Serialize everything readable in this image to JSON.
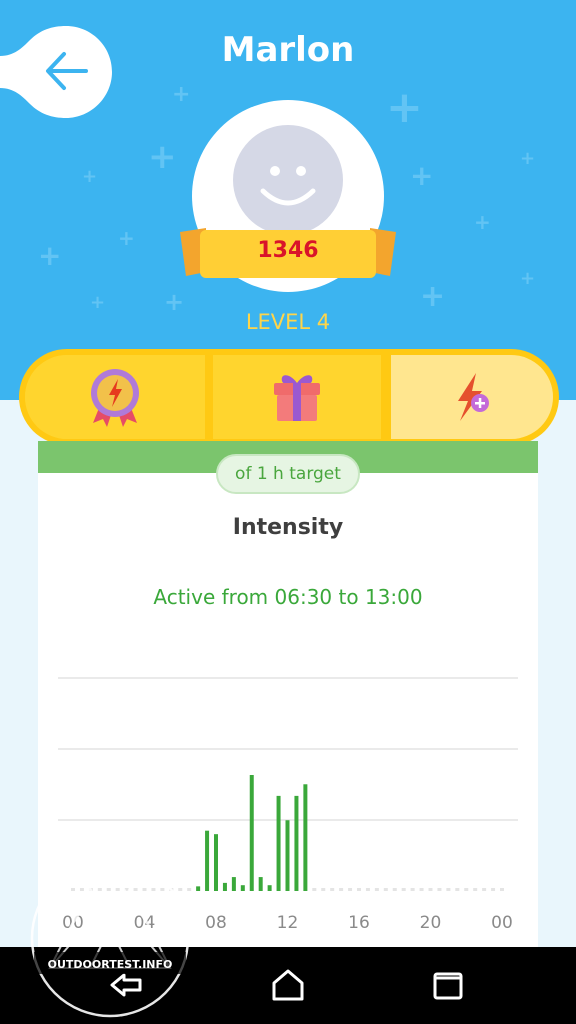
{
  "header": {
    "title": "Marlon",
    "score": "1346",
    "level": "LEVEL 4"
  },
  "icons": {
    "back": "arrow-left-icon",
    "tab1": "badge-lightning-icon",
    "tab2": "gift-icon",
    "tab3": "lightning-plus-icon",
    "nav_back": "nav-back-icon",
    "nav_home": "nav-home-icon",
    "nav_recents": "nav-recents-icon"
  },
  "card": {
    "target": "of 1 h target",
    "title": "Intensity",
    "active": "Active from 06:30 to 13:00"
  },
  "colors": {
    "header_blue": "#3cb4f0",
    "tabbar_yellow": "#ffc913",
    "score_red": "#d9142a",
    "level_yellow": "#ffd54a",
    "activity_green": "#3aa83a",
    "card_green": "#7bc56d"
  },
  "chart_data": {
    "type": "bar",
    "title": "Intensity",
    "x_ticks": [
      "00",
      "04",
      "08",
      "12",
      "16",
      "20",
      "00"
    ],
    "x_range_hours": [
      0,
      24
    ],
    "ylim": [
      0,
      1
    ],
    "values": [
      {
        "x": 7.0,
        "y": 0.04
      },
      {
        "x": 7.5,
        "y": 0.52
      },
      {
        "x": 8.0,
        "y": 0.49
      },
      {
        "x": 8.5,
        "y": 0.07
      },
      {
        "x": 9.0,
        "y": 0.12
      },
      {
        "x": 9.5,
        "y": 0.05
      },
      {
        "x": 10.0,
        "y": 1.0
      },
      {
        "x": 10.5,
        "y": 0.12
      },
      {
        "x": 11.0,
        "y": 0.05
      },
      {
        "x": 11.5,
        "y": 0.82
      },
      {
        "x": 12.0,
        "y": 0.61
      },
      {
        "x": 12.5,
        "y": 0.82
      },
      {
        "x": 13.0,
        "y": 0.92
      }
    ],
    "grid": true,
    "watermark": "OUTDOORTEST.INFO"
  }
}
